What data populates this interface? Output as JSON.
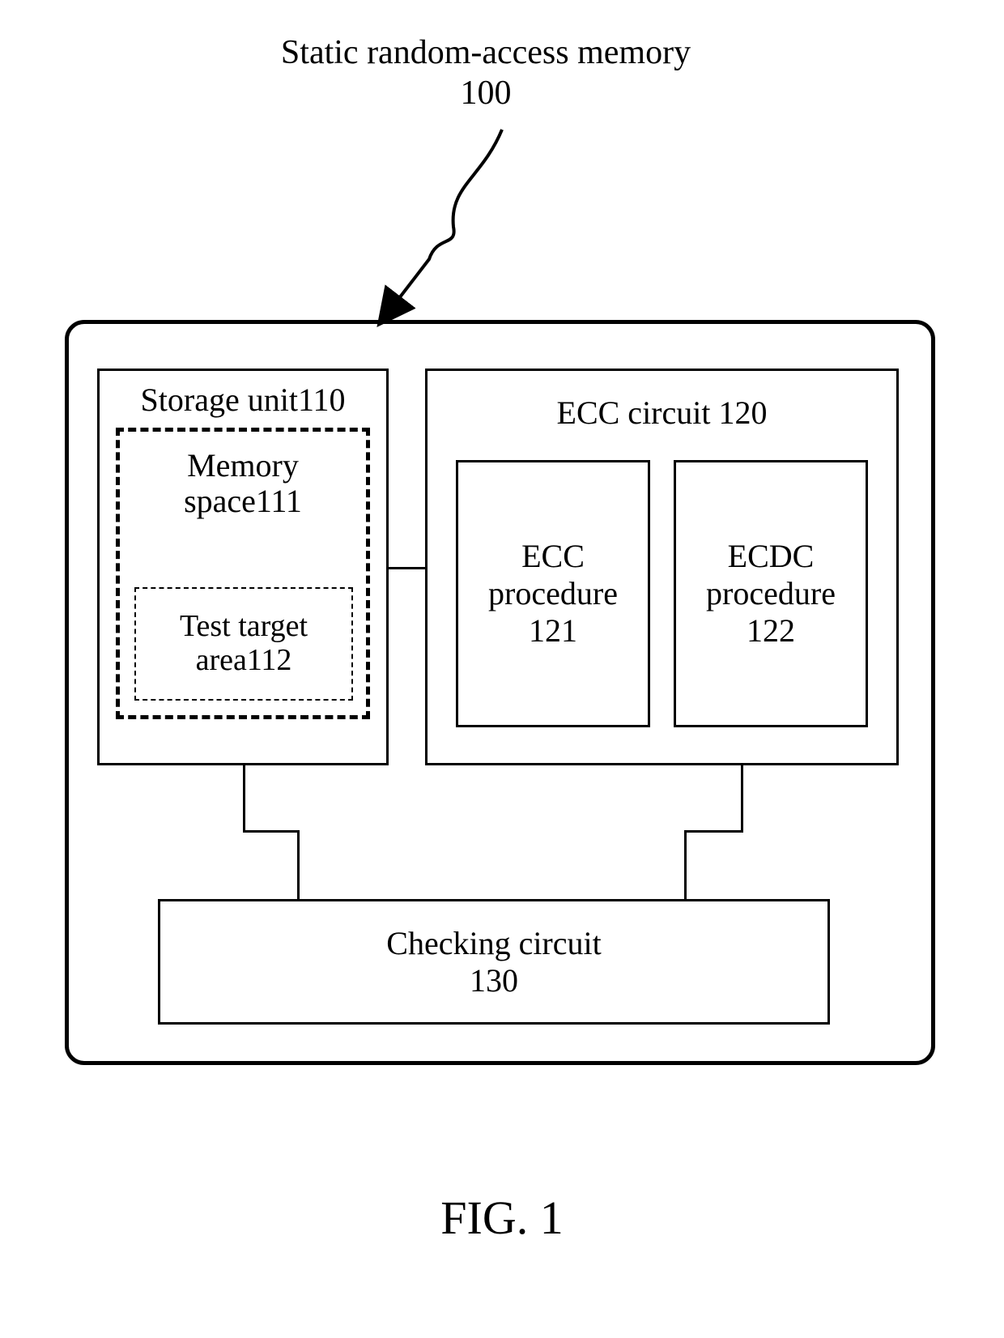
{
  "title_line1": "Static random-access memory",
  "title_line2": "100",
  "fig_caption": "FIG. 1",
  "storage_unit": "Storage unit110",
  "memory_space_l1": "Memory",
  "memory_space_l2": "space111",
  "test_target_l1": "Test target",
  "test_target_l2": "area112",
  "ecc_circuit": "ECC circuit 120",
  "ecc_proc_l1": "ECC",
  "ecc_proc_l2": "procedure",
  "ecc_proc_l3": "121",
  "ecdc_proc_l1": "ECDC",
  "ecdc_proc_l2": "procedure",
  "ecdc_proc_l3": "122",
  "checking_l1": "Checking circuit",
  "checking_l2": "130"
}
